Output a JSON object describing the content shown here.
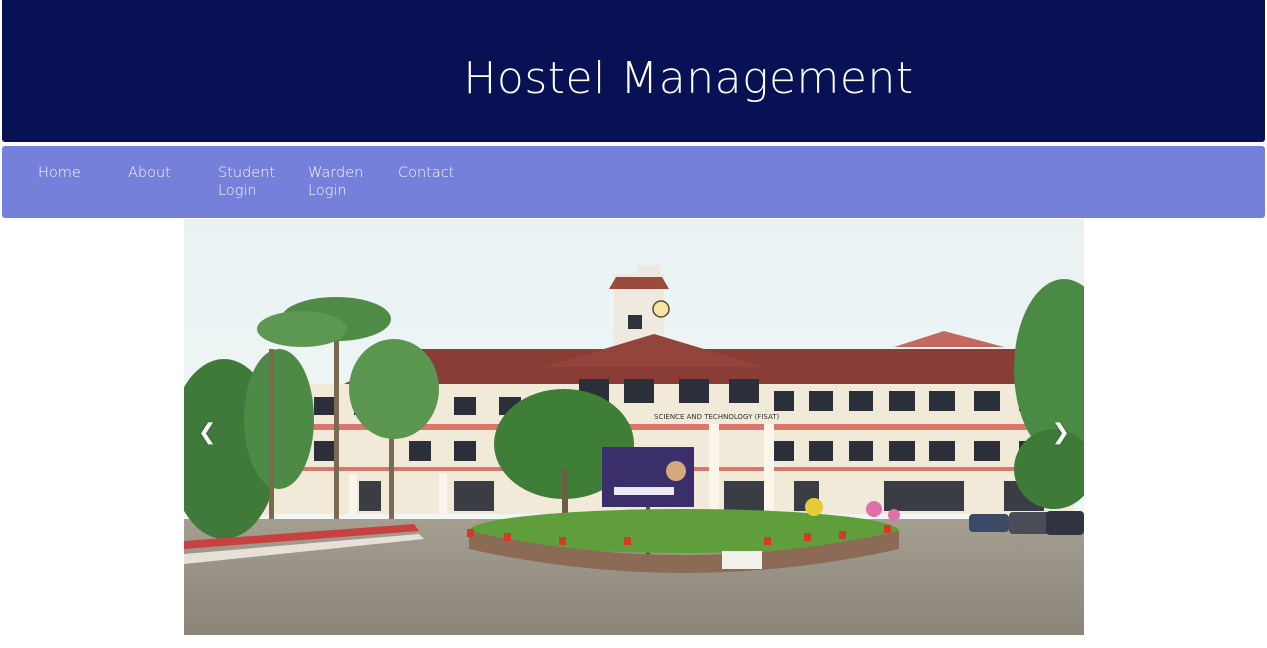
{
  "header": {
    "title": "Hostel Management"
  },
  "nav": {
    "items": [
      {
        "label": "Home"
      },
      {
        "label": "About"
      },
      {
        "label": "Student Login"
      },
      {
        "label": "Warden Login"
      },
      {
        "label": "Contact"
      }
    ]
  },
  "slideshow": {
    "prev_label": "❮",
    "next_label": "❯",
    "image": {
      "building_sign": "SCIENCE AND TECHNOLOGY (FISAT)"
    }
  },
  "colors": {
    "header_bg": "#081153",
    "nav_bg": "#7480da",
    "text": "#ffffff"
  }
}
